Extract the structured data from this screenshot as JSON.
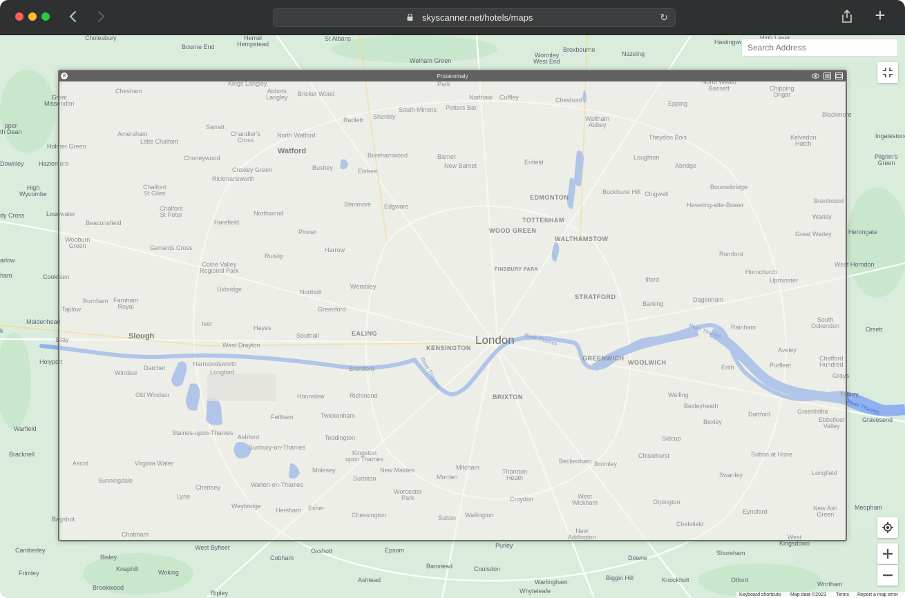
{
  "browser": {
    "url": "skyscanner.net/hotels/maps"
  },
  "overlay": {
    "title": "Protanomaly"
  },
  "map": {
    "search_placeholder": "Search Address",
    "attribution": {
      "shortcuts": "Keyboard shortcuts",
      "map_data": "Map data ©2023",
      "terms": "Terms",
      "report": "Report a map error"
    },
    "major": {
      "london": "London",
      "watford": "Watford",
      "slough": "Slough"
    },
    "areas": {
      "edmonton": "EDMONTON",
      "tottenham": "TOTTENHAM",
      "wood_green": "WOOD GREEN",
      "walthamstow": "WALTHAMSTOW",
      "finsbury_park": "FINSBURY PARK",
      "stratford": "STRATFORD",
      "ealing": "EALING",
      "kensington": "KENSINGTON",
      "greenwich": "GREENWICH",
      "woolwich": "WOOLWICH",
      "brixton": "BRIXTON"
    },
    "rivers": {
      "thames1": "River Thames",
      "thames2": "River Thames",
      "thames3": "River Thames",
      "thames4": "River Thames"
    },
    "places": {
      "cholesbury": "Cholesbury",
      "hemel": "Hemel\nHempstead",
      "st_albans": "St Albans",
      "welham_green": "Welham Green",
      "broxbourne": "Broxbourne",
      "nazeing": "Nazeing",
      "hastingwood": "Hastingwood",
      "high_laver": "High Laver",
      "bourne_end": "Bourne End",
      "wormley": "Wormley\nWest End",
      "kings_langley": "Kings Langley",
      "abbots": "Abbots\nLangley",
      "bricket": "Bricket Wood",
      "park": "Park",
      "northaw": "Northaw",
      "cuffley": "Cuffley",
      "cheshunt": "Cheshunt",
      "north_weald": "North Weald\nBassett",
      "chipping_ongar": "Chipping\nOngar",
      "chesham": "Chesham",
      "great_missenden": "Great\nMissenden",
      "south_mimms": "South Mimms",
      "potters_bar": "Potters Bar",
      "epping": "Epping",
      "blackmore": "Blackmore",
      "radlett": "Radlett",
      "shenley": "Shenley",
      "waltham_abbey": "Waltham\nAbbey",
      "upper": "pper\nth Dean",
      "sarratt": "Sarratt",
      "amersham": "Amersham",
      "chandlers": "Chandler's\nCross",
      "north_watford": "North Watford",
      "kelvedon": "Kelvedon\nHatch",
      "ingatestone": "Ingatestone",
      "little_chalfont": "Little Chalfont",
      "holmer": "Holmer Green",
      "theydon": "Theydon Bois",
      "borehamwood": "Borehamwood",
      "barnet": "Barnet",
      "chorleywood": "Chorleywood",
      "downley": "Downley",
      "hazlemere": "Hazlemere",
      "new_barnet": "New Barnet",
      "enfield": "Enfield",
      "loughton": "Loughton",
      "abridge": "Abridge",
      "pilgrims": "Pilgrim's\nGreen",
      "bushey": "Bushey",
      "croxley": "Croxley Green",
      "elstree": "Elstree",
      "high_wycombe": "High\nWycombe",
      "rickmansworth": "Rickmansworth",
      "chalfont_giles": "Chalfont\nSt Giles",
      "bournebridge": "Bournebridge",
      "buckhurst": "Buckhurst Hill",
      "chigwell": "Chigwell",
      "loudwater": "Loudwater",
      "stanmore": "Stanmore",
      "edgware": "Edgware",
      "havering": "Havering-atte-Bower",
      "brentwood": "Brentwood",
      "dy_cross": "dy Cross",
      "chalfont_peter": "Chalfont\nSt Peter",
      "northwood": "Northwood",
      "beaconsfield": "Beaconsfield",
      "harefield": "Harefield",
      "warley": "Warley",
      "pinner": "Pinner",
      "herongate": "Herongate",
      "great_warley": "Great Warley",
      "wooburn": "Wooburn\nGreen",
      "gerrards": "Gerrards Cross",
      "harrow": "Harrow",
      "romford": "Romford",
      "ruislip": "Ruislip",
      "marlow": "arlow",
      "colne_valley": "Colne Valley\nRegional Park",
      "west_horndon": "West Horndon",
      "ham": "ham",
      "cookham": "Cookham",
      "hornchurch": "Hornchurch",
      "upminster": "Upminster",
      "ilford": "Ilford",
      "wembley": "Wembley",
      "uxbridge": "Uxbridge",
      "northolt": "Northolt",
      "burnham": "Burnham",
      "farnham_royal": "Farnham\nRoyal",
      "dagenham": "Dagenham",
      "barking": "Barking",
      "taplow": "Taplow",
      "greenford": "Greenford",
      "maidenhead": "Maidenhead",
      "iver": "Iver",
      "hayes": "Hayes",
      "south_ockendon": "South\nOckendon",
      "rainham": "Rainham",
      "orsett": "Orsett",
      "southall": "Southall",
      "bray": "Bray",
      "k": "k",
      "west_drayton": "West Drayton",
      "aveley": "Aveley",
      "holyport": "Holyport",
      "chafford": "Chafford\nHundred",
      "datchet": "Datchet",
      "harmondsworth": "Harmondsworth",
      "purfleet": "Purfleet",
      "windsor": "Windsor",
      "longford": "Longford",
      "brentford": "Brentford",
      "erith": "Erith",
      "grays": "Grays",
      "hounslow": "Hounslow",
      "richmond": "Richmond",
      "old_windsor": "Old Windsor",
      "welling": "Welling",
      "tilbury": "Tilbury",
      "feltham": "Feltham",
      "twickenham": "Twickenham",
      "bexleyheath": "Bexleyheath",
      "greenhithe": "Greenhithe",
      "dartford": "Dartford",
      "ebbsfleet": "Ebbsfleet\nValley",
      "gravesend": "Gravesend",
      "bexley": "Bexley",
      "warfield": "Warfield",
      "staines": "Staines-upon-Thames",
      "ashford": "Ashford",
      "teddington": "Teddington",
      "sidcup": "Sidcup",
      "bracknell": "Bracknell",
      "sunbury": "Sunbury-on-Thames",
      "kingston": "Kingston\nupon Thames",
      "chislehurst": "Chislehurst",
      "sutton_hone": "Sutton at Hone",
      "ascot": "Ascot",
      "virginia_water": "Virginia Water",
      "beckenham": "Beckenham",
      "bromley": "Bromley",
      "mitcham": "Mitcham",
      "molesey": "Molesey",
      "new_malden": "New Malden",
      "thornton_heath": "Thornton\nHeath",
      "longfield": "Longfield",
      "sunningdale": "Sunningdale",
      "morden": "Morden",
      "surbiton": "Surbiton",
      "swanley": "Swanley",
      "walton": "Walton-on-Thames",
      "chertsey": "Chertsey",
      "lyne": "Lyne",
      "worcester_park": "Worcester\nPark",
      "croydon": "Croydon",
      "west_wickham": "West\nWickham",
      "orpington": "Orpington",
      "weybridge": "Weybridge",
      "esher": "Esher",
      "hersham": "Hersham",
      "chessington": "Chessington",
      "eynsford": "Eynsford",
      "new_ash_green": "New Ash\nGreen",
      "meopham": "Meopham",
      "bagshot": "Bagshot",
      "sutton": "Sutton",
      "wallington": "Wallington",
      "chelsfield": "Chelsfield",
      "chobham": "Chobham",
      "new_addington": "New\nAddington",
      "purley": "Purley",
      "west_kingsdown": "West\nKingsdown",
      "camberley": "Camberley",
      "west_byfleet": "West Byfleet",
      "oxshott": "Oxshott",
      "epsom": "Epsom",
      "downe": "Downe",
      "shoreham": "Shoreham",
      "bisley": "Bisley",
      "cobham": "Cobham",
      "banstead": "Banstead",
      "knaphill": "Knaphill",
      "woking": "Woking",
      "coulsdon": "Coulsdon",
      "frimley": "Frimley",
      "biggin_hill": "Biggin Hill",
      "ashtead": "Ashtead",
      "warlingham": "Warlingham",
      "knockholt": "Knockholt",
      "otford": "Otford",
      "wrotham": "Wrotham",
      "brookwood": "Brookwood",
      "whyteleafe": "Whyteleafe",
      "ripley": "Ripley"
    }
  }
}
